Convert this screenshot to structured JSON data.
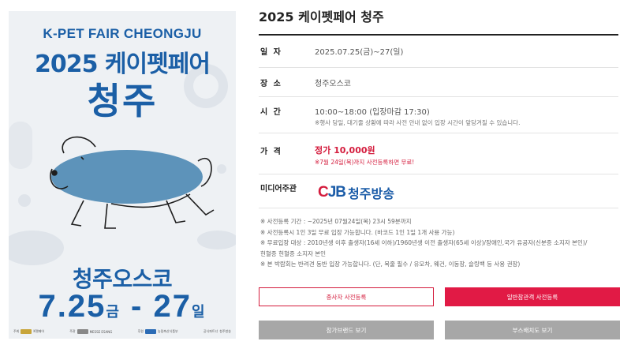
{
  "poster": {
    "english_title": "K-PET FAIR CHEONGJU",
    "korean_title": "2025 케이펫페어",
    "city": "청주",
    "venue": "청주오스코",
    "date_main": "7.25",
    "date_day1": "금",
    "date_dash": " - ",
    "date_end": "27",
    "date_day2": "일",
    "sponsors": [
      "주최",
      "K펫페어",
      "주관",
      "MESSE ESANG",
      "후원",
      "농림축산식품부",
      "공식파트너",
      "청주방송"
    ]
  },
  "event": {
    "title": "2025 케이펫페어 청주",
    "date_label": "일 자",
    "date_value": "2025.07.25(금)~27(일)",
    "venue_label": "장 소",
    "venue_value": "청주오스코",
    "time_label": "시 간",
    "time_value": "10:00~18:00 (입장마감 17:30)",
    "time_note": "※행사 당일, 대기줄 상황에 따라 사전 안내 없이 입장 시간이 앞당겨질 수 있습니다.",
    "price_label": "가 격",
    "price_value": "정가 10,000원",
    "price_note": "※7월 24일(목)까지 사전등록하면 무료!",
    "media_label": "미디어주관",
    "media_logo_c": "C",
    "media_logo_rest": "JB",
    "media_name": "청주방송"
  },
  "notices": [
    "※ 사전등록 기간 : ~2025년 07월24일(목) 23시 59분까지",
    "※ 사전등록시 1인 3일 무료 입장 가능합니다. (바코드 1인 1일 1개 사용 가능)",
    "※ 무료입장 대상 : 2010년생 이후 출생자(16세 이하)/1960년생 이전 출생자(65세 이상)/장애인,국가 유공자(신분증 소지자 본인)/",
    "헌혈증 헌혈증 소지자 본인",
    "※ 본 박람회는 반려견 동반 입장 가능합니다. (단, 목줄 필수 / 유모차, 웨건, 이동장, 슬링백 등 사용 권장)"
  ],
  "buttons": {
    "exhibitor_register": "종사자 사전등록",
    "general_register": "일반참관객 사전등록",
    "brands": "참가브랜드 보기",
    "booth_map": "부스배치도 보기"
  },
  "colors": {
    "brand_blue": "#1b5fa6",
    "accent_red": "#e11a45",
    "dog_blue": "#5d93ba"
  }
}
